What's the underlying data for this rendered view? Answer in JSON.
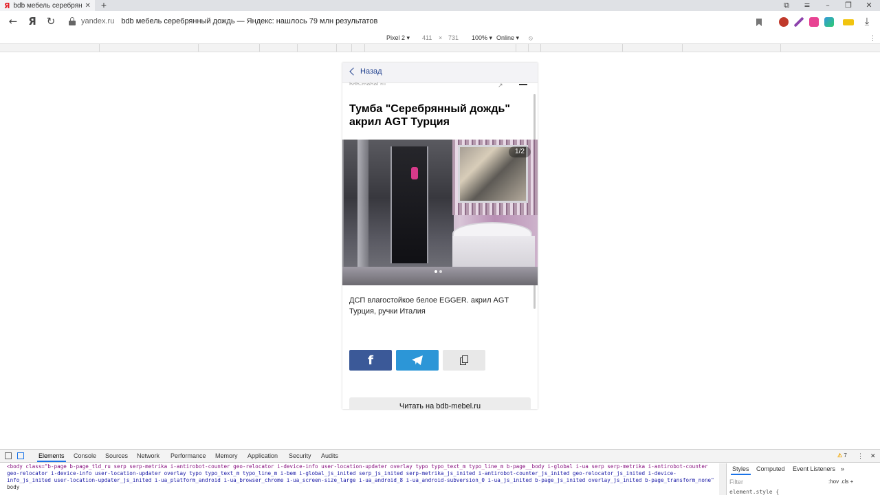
{
  "browser": {
    "tab_title": "bdb мебель серебрянн",
    "tab_favicon": "Я",
    "new_tab": "+",
    "omnibox_host": "yandex.ru",
    "omnibox_title": "bdb мебель серебрянный дождь — Яндекс: нашлось 79 млн результатов",
    "yandex_btn": "Я"
  },
  "device_toolbar": {
    "device": "Pixel 2 ▾",
    "width": "411",
    "times": "×",
    "height": "731",
    "zoom": "100% ▾",
    "throttle": "Online ▾"
  },
  "page": {
    "back_label": "Назад",
    "site_peek": "bdb-mebel.ru",
    "title": "Тумба \"Серебрянный дождь\" акрил AGT Турция",
    "counter": "1/2",
    "description": "ДСП влагостойкое белое EGGER. акрил AGT Турция, ручки Италия",
    "facebook_glyph": "f",
    "read_button": "Читать на bdb-mebel.ru"
  },
  "devtools": {
    "tabs": [
      "Elements",
      "Console",
      "Sources",
      "Network",
      "Performance",
      "Memory",
      "Application",
      "Security",
      "Audits"
    ],
    "warnings": "7",
    "code_line_1": "<body class=\"b-page b-page_tld_ru serp serp-metrika i-antirobot-counter geo-relocator i-device-info user-location-updater overlay typo typo_text_m typo_line_m b-page__body i-global i-ua serp serp-metrika i-antirobot-counter",
    "code_line_2": "geo-relocator i-device-info user-location-updater overlay typo typo_text_m typo_line_m i-bem i-global_js_inited serp_js_inited serp-metrika_js_inited i-antirobot-counter_js_inited geo-relocator_js_inited i-device-",
    "code_line_3": "info_js_inited user-location-updater_js_inited i-ua_platform_android i-ua_browser_chrome i-ua_screen-size_large i-ua_android_8 i-ua_android-subversion_0 i-ua_js_inited b-page_js_inited overlay_js_inited b-page_transform_none\"",
    "code_line_4": "body",
    "side_tabs": [
      "Styles",
      "Computed",
      "Event Listeners"
    ],
    "filter_placeholder": "Filter",
    "hov_cls": ":hov .cls +",
    "element_style": "element.style {"
  },
  "colors": {
    "facebook": "#3b5998",
    "telegram": "#2c96d7",
    "link": "#1e3e8c"
  }
}
